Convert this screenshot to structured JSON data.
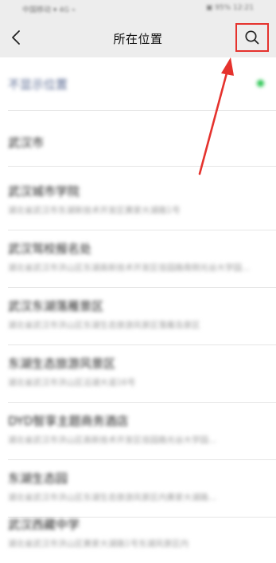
{
  "status_bar": {
    "left_text": "中国移动 ▾ 4G ⌁",
    "right_text": "▣ 95%  12:21"
  },
  "nav": {
    "title": "所在位置",
    "back_icon": "chevron-left-icon",
    "search_icon": "search-icon"
  },
  "no_location": {
    "label": "不显示位置",
    "accent_color": "#2bc653"
  },
  "city": {
    "label": "武汉市"
  },
  "places": [
    {
      "name": "武汉城市学院",
      "address": "湖北省武汉市东湖新技术开发区黄家大湖路1号"
    },
    {
      "name": "武汉驾校报名处",
      "address": "湖北省武汉市洪山区东湖高新技术开发区佳园路南侧光谷大学园..."
    },
    {
      "name": "武汉东湖落雁景区",
      "address": "湖北省武汉市洪山区东湖生态旅游风景区落雁岛景区"
    },
    {
      "name": "东湖生态旅游风景区",
      "address": "湖北省武汉市洪山区沿湖大道16号"
    },
    {
      "name": "DYD智享主题商务酒店",
      "address": "湖北省武汉市洪山区高新技术开发区佳园路光谷大学园..."
    },
    {
      "name": "东湖生态园",
      "address": "湖北省武汉市洪山区东湖生态旅游风景区内黄家大湖路..."
    },
    {
      "name": "武汉西藏中学",
      "address": "湖北省武汉市洪山区黄家大湖路1号东湖风景区内"
    }
  ],
  "annotation": {
    "highlight_color": "#e5322d"
  }
}
